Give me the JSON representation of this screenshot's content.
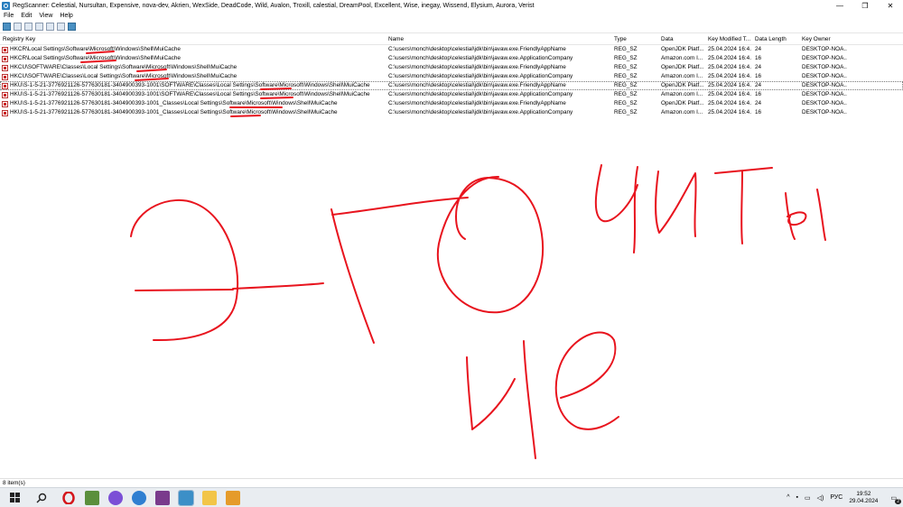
{
  "window": {
    "title": "RegScanner:  Celestial, Nursultan, Expensive, nova-dev, Akrien, WexSide, DeadCode, Wild, Avalon, Troxill, calestial, DreamPool, Excellent, Wise, inegay, Wissend, Elysium, Aurora, Verist",
    "minimize": "—",
    "maximize": "❐",
    "close": "✕",
    "close_color": "#e81123"
  },
  "menu": [
    "File",
    "Edit",
    "View",
    "Help"
  ],
  "toolbar_icons": [
    "scan-icon",
    "new-icon",
    "save-icon",
    "copy-icon",
    "properties-icon",
    "find-icon",
    "regedit-icon"
  ],
  "columns": [
    "Registry Key",
    "Name",
    "Type",
    "Data",
    "Key Modified T...",
    "Data Length",
    "Key Owner"
  ],
  "rows": [
    {
      "key": "HKCR\\Local Settings\\Software\\Microsoft\\Windows\\Shell\\MuiCache",
      "name": "C:\\users\\monch\\desktop\\celestial\\jdk\\bin\\javaw.exe.FriendlyAppName",
      "type": "REG_SZ",
      "data": "OpenJDK Platf...",
      "modified": "25.04.2024 16:4...",
      "length": "24",
      "owner": "DESKTOP-NOA..."
    },
    {
      "key": "HKCR\\Local Settings\\Software\\Microsoft\\Windows\\Shell\\MuiCache",
      "name": "C:\\users\\monch\\desktop\\celestial\\jdk\\bin\\javaw.exe.ApplicationCompany",
      "type": "REG_SZ",
      "data": "Amazon.com I...",
      "modified": "25.04.2024 16:4...",
      "length": "16",
      "owner": "DESKTOP-NOA..."
    },
    {
      "key": "HKCU\\SOFTWARE\\Classes\\Local Settings\\Software\\Microsoft\\Windows\\Shell\\MuiCache",
      "name": "C:\\users\\monch\\desktop\\celestial\\jdk\\bin\\javaw.exe.FriendlyAppName",
      "type": "REG_SZ",
      "data": "OpenJDK Platf...",
      "modified": "25.04.2024 16:4...",
      "length": "24",
      "owner": "DESKTOP-NOA..."
    },
    {
      "key": "HKCU\\SOFTWARE\\Classes\\Local Settings\\Software\\Microsoft\\Windows\\Shell\\MuiCache",
      "name": "C:\\users\\monch\\desktop\\celestial\\jdk\\bin\\javaw.exe.ApplicationCompany",
      "type": "REG_SZ",
      "data": "Amazon.com I...",
      "modified": "25.04.2024 16:4...",
      "length": "16",
      "owner": "DESKTOP-NOA..."
    },
    {
      "key": "HKU\\S-1-5-21-3776921126-577630181-3404900393-1001\\SOFTWARE\\Classes\\Local Settings\\Software\\Microsoft\\Windows\\Shell\\MuiCache",
      "name": "C:\\users\\monch\\desktop\\celestial\\jdk\\bin\\javaw.exe.FriendlyAppName",
      "type": "REG_SZ",
      "data": "OpenJDK Platf...",
      "modified": "25.04.2024 16:4...",
      "length": "24",
      "owner": "DESKTOP-NOA...",
      "focused": true
    },
    {
      "key": "HKU\\S-1-5-21-3776921126-577630181-3404900393-1001\\SOFTWARE\\Classes\\Local Settings\\Software\\Microsoft\\Windows\\Shell\\MuiCache",
      "name": "C:\\users\\monch\\desktop\\celestial\\jdk\\bin\\javaw.exe.ApplicationCompany",
      "type": "REG_SZ",
      "data": "Amazon.com I...",
      "modified": "25.04.2024 16:4...",
      "length": "16",
      "owner": "DESKTOP-NOA..."
    },
    {
      "key": "HKU\\S-1-5-21-3776921126-577630181-3404900393-1001_Classes\\Local Settings\\Software\\Microsoft\\Windows\\Shell\\MuiCache",
      "name": "C:\\users\\monch\\desktop\\celestial\\jdk\\bin\\javaw.exe.FriendlyAppName",
      "type": "REG_SZ",
      "data": "OpenJDK Platf...",
      "modified": "25.04.2024 16:4...",
      "length": "24",
      "owner": "DESKTOP-NOA..."
    },
    {
      "key": "HKU\\S-1-5-21-3776921126-577630181-3404900393-1001_Classes\\Local Settings\\Software\\Microsoft\\Windows\\Shell\\MuiCache",
      "name": "C:\\users\\monch\\desktop\\celestial\\jdk\\bin\\javaw.exe.ApplicationCompany",
      "type": "REG_SZ",
      "data": "Amazon.com I...",
      "modified": "25.04.2024 16:4...",
      "length": "16",
      "owner": "DESKTOP-NOA..."
    }
  ],
  "status": "8 item(s)",
  "annotation": {
    "text": "ЭТО ЧИТЫ ЧЕ",
    "color": "#e8141e"
  },
  "taskbar": {
    "icons": [
      "windows-start-icon",
      "search-icon",
      "opera-icon",
      "minecraft-icon",
      "messenger-icon",
      "browser-icon",
      "winrar-icon",
      "regscanner-icon",
      "file-explorer-icon",
      "media-player-icon"
    ],
    "tray": {
      "language": "РУС",
      "time": "19:52",
      "date": "29.04.2024",
      "notifications": "2"
    }
  }
}
